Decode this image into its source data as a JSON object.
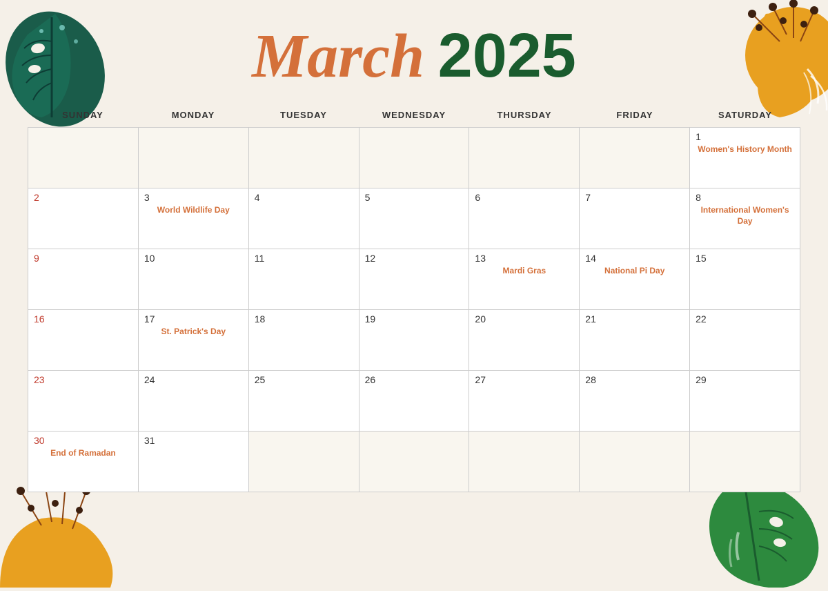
{
  "header": {
    "month": "March",
    "year": "2025"
  },
  "days": {
    "headers": [
      "SUNDAY",
      "MONDAY",
      "TUESDAY",
      "WEDNESDAY",
      "THURSDAY",
      "FRIDAY",
      "SATURDAY"
    ]
  },
  "cells": [
    {
      "date": "",
      "event": "",
      "sunday": false,
      "empty": true
    },
    {
      "date": "",
      "event": "",
      "sunday": false,
      "empty": true
    },
    {
      "date": "",
      "event": "",
      "sunday": false,
      "empty": true
    },
    {
      "date": "",
      "event": "",
      "sunday": false,
      "empty": true
    },
    {
      "date": "",
      "event": "",
      "sunday": false,
      "empty": true
    },
    {
      "date": "",
      "event": "",
      "sunday": false,
      "empty": true
    },
    {
      "date": "1",
      "event": "Women's History Month",
      "sunday": false,
      "empty": false,
      "eventColor": "orange"
    },
    {
      "date": "2",
      "event": "",
      "sunday": true,
      "empty": false
    },
    {
      "date": "3",
      "event": "World Wildlife Day",
      "sunday": false,
      "empty": false,
      "eventColor": "orange"
    },
    {
      "date": "4",
      "event": "",
      "sunday": false,
      "empty": false
    },
    {
      "date": "5",
      "event": "",
      "sunday": false,
      "empty": false
    },
    {
      "date": "6",
      "event": "",
      "sunday": false,
      "empty": false
    },
    {
      "date": "7",
      "event": "",
      "sunday": false,
      "empty": false
    },
    {
      "date": "8",
      "event": "International Women's Day",
      "sunday": false,
      "empty": false,
      "eventColor": "orange"
    },
    {
      "date": "9",
      "event": "",
      "sunday": true,
      "empty": false
    },
    {
      "date": "10",
      "event": "",
      "sunday": false,
      "empty": false
    },
    {
      "date": "11",
      "event": "",
      "sunday": false,
      "empty": false
    },
    {
      "date": "12",
      "event": "",
      "sunday": false,
      "empty": false
    },
    {
      "date": "13",
      "event": "Mardi Gras",
      "sunday": false,
      "empty": false,
      "eventColor": "orange"
    },
    {
      "date": "14",
      "event": "National Pi Day",
      "sunday": false,
      "empty": false,
      "eventColor": "orange"
    },
    {
      "date": "15",
      "event": "",
      "sunday": false,
      "empty": false
    },
    {
      "date": "16",
      "event": "",
      "sunday": true,
      "empty": false
    },
    {
      "date": "17",
      "event": "St. Patrick's Day",
      "sunday": false,
      "empty": false,
      "eventColor": "orange"
    },
    {
      "date": "18",
      "event": "",
      "sunday": false,
      "empty": false
    },
    {
      "date": "19",
      "event": "",
      "sunday": false,
      "empty": false
    },
    {
      "date": "20",
      "event": "",
      "sunday": false,
      "empty": false
    },
    {
      "date": "21",
      "event": "",
      "sunday": false,
      "empty": false
    },
    {
      "date": "22",
      "event": "",
      "sunday": false,
      "empty": false
    },
    {
      "date": "23",
      "event": "",
      "sunday": true,
      "empty": false
    },
    {
      "date": "24",
      "event": "",
      "sunday": false,
      "empty": false
    },
    {
      "date": "25",
      "event": "",
      "sunday": false,
      "empty": false
    },
    {
      "date": "26",
      "event": "",
      "sunday": false,
      "empty": false
    },
    {
      "date": "27",
      "event": "",
      "sunday": false,
      "empty": false
    },
    {
      "date": "28",
      "event": "",
      "sunday": false,
      "empty": false
    },
    {
      "date": "29",
      "event": "",
      "sunday": false,
      "empty": false
    },
    {
      "date": "30",
      "event": "End of Ramadan",
      "sunday": true,
      "empty": false,
      "eventColor": "orange"
    },
    {
      "date": "31",
      "event": "",
      "sunday": false,
      "empty": false
    },
    {
      "date": "",
      "event": "",
      "sunday": false,
      "empty": true
    },
    {
      "date": "",
      "event": "",
      "sunday": false,
      "empty": true
    },
    {
      "date": "",
      "event": "",
      "sunday": false,
      "empty": true
    },
    {
      "date": "",
      "event": "",
      "sunday": false,
      "empty": true
    },
    {
      "date": "",
      "event": "",
      "sunday": false,
      "empty": true
    }
  ]
}
